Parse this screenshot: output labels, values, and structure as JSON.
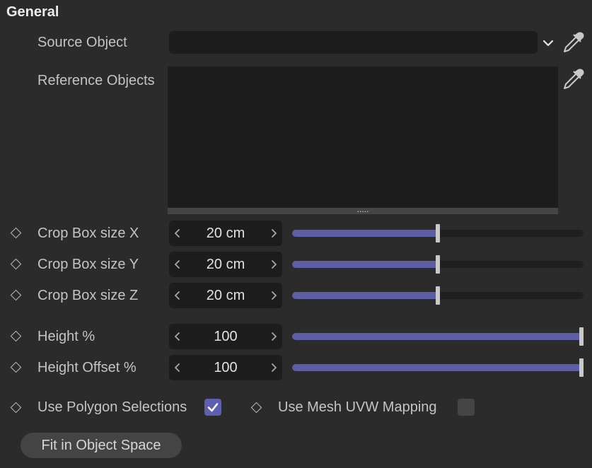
{
  "section": {
    "title": "General"
  },
  "source_object": {
    "label": "Source Object",
    "value": ""
  },
  "reference_objects": {
    "label": "Reference Objects"
  },
  "resize_handle": {
    "dots": "....."
  },
  "params": [
    {
      "label": "Crop Box size X",
      "value": "20 cm",
      "slider_fraction": 0.5
    },
    {
      "label": "Crop Box size Y",
      "value": "20 cm",
      "slider_fraction": 0.5
    },
    {
      "label": "Crop Box size Z",
      "value": "20 cm",
      "slider_fraction": 0.5
    },
    {
      "label": "Height %",
      "value": "100",
      "slider_fraction": 1.0
    },
    {
      "label": "Height Offset %",
      "value": "100",
      "slider_fraction": 1.0
    }
  ],
  "checkboxes": {
    "polygon": {
      "label": "Use Polygon Selections",
      "checked": true
    },
    "uvw": {
      "label": "Use Mesh UVW Mapping",
      "checked": false
    }
  },
  "button": {
    "label": "Fit in Object Space"
  },
  "colors": {
    "background": "#2b2b2b",
    "field": "#1d1d1d",
    "accent": "#5e5ea6",
    "thumb": "#c9c9c9"
  }
}
